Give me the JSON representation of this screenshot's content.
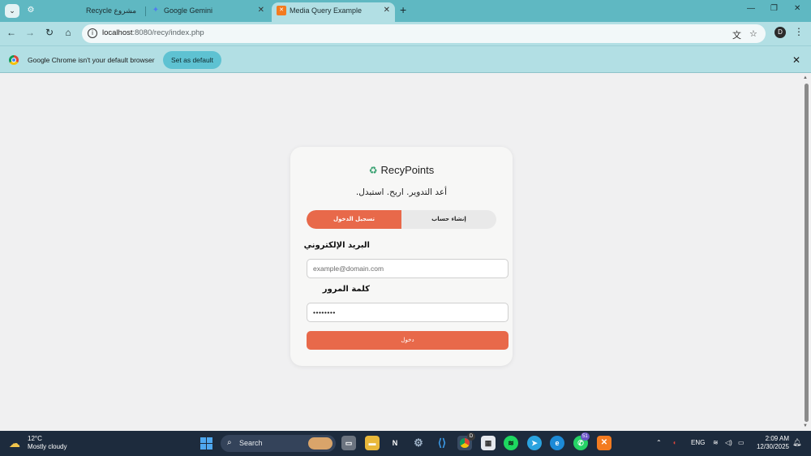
{
  "browser": {
    "tabs": [
      {
        "label": "Recycle مشروع",
        "icon": "settings-icon"
      },
      {
        "label": "Google Gemini",
        "icon": "gemini-icon"
      },
      {
        "label": "Media Query Example",
        "icon": "xampp-icon",
        "active": true
      }
    ],
    "address": {
      "host": "localhost",
      "path": ":8080/recy/index.php"
    },
    "profile_initial": "D"
  },
  "infobar": {
    "message": "Google Chrome isn't your default browser",
    "button": "Set as default"
  },
  "card": {
    "brand": "RecyPoints",
    "tagline": "أعد التدوير. اربح. استبدل.",
    "tabs": {
      "login": "تسجيل الدخول",
      "signup": "إنشاء حساب"
    },
    "email_label": "البريد الإلكتروني",
    "email_placeholder": "example@domain.com",
    "password_label": "كلمة المرور",
    "password_value": "••••••••",
    "submit": "دخول",
    "accent_color": "#e8694a"
  },
  "taskbar": {
    "weather": {
      "temp": "12°C",
      "desc": "Mostly cloudy"
    },
    "search": "Search",
    "badges": {
      "chrome": "D",
      "whatsapp": "51"
    },
    "language": "ENG",
    "time": "2:09 AM",
    "date": "12/30/2025"
  }
}
